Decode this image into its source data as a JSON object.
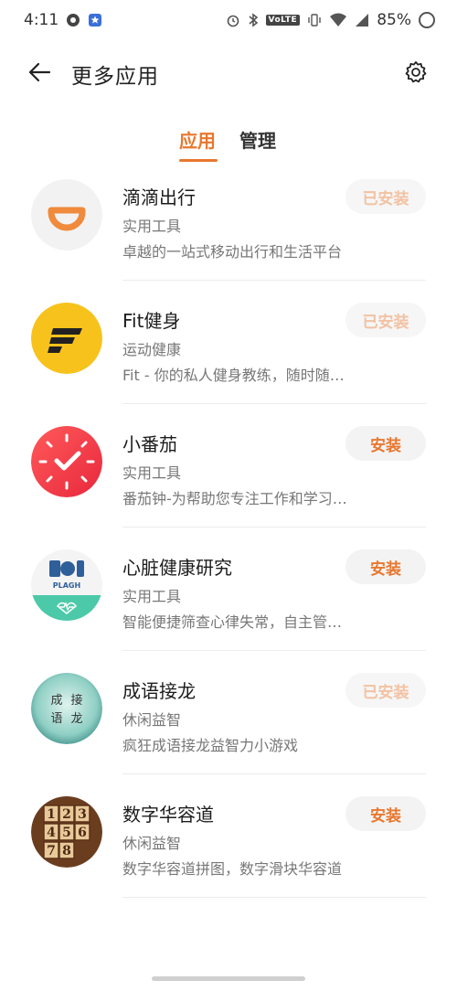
{
  "status_bar": {
    "time": "4:11",
    "battery": "85%",
    "network_label": "VoLTE",
    "icons_left": [
      "soccer-ball-icon",
      "star-badge-icon"
    ],
    "icons_right": [
      "alarm-icon",
      "bluetooth-icon",
      "volte-icon",
      "vibrate-icon",
      "wifi-icon",
      "signal-icon",
      "battery-icon"
    ]
  },
  "header": {
    "title": "更多应用"
  },
  "tabs": [
    {
      "label": "应用",
      "active": true
    },
    {
      "label": "管理",
      "active": false
    }
  ],
  "apps": [
    {
      "name": "滴滴出行",
      "category": "实用工具",
      "description": "卓越的一站式移动出行和生活平台",
      "button": "已安装",
      "installed": true,
      "icon": "didi-logo-icon"
    },
    {
      "name": "Fit健身",
      "category": "运动健康",
      "description": "Fit - 你的私人健身教练，随时随…",
      "button": "已安装",
      "installed": true,
      "icon": "fit-logo-icon"
    },
    {
      "name": "小番茄",
      "category": "实用工具",
      "description": "番茄钟-为帮助您专注工作和学习…",
      "button": "安装",
      "installed": false,
      "icon": "tomato-clock-icon"
    },
    {
      "name": "心脏健康研究",
      "category": "实用工具",
      "description": "智能便捷筛查心律失常，自主管…",
      "button": "安装",
      "installed": false,
      "icon": "heart-health-icon",
      "icon_text": "PLAGH"
    },
    {
      "name": "成语接龙",
      "category": "休闲益智",
      "description": "疯狂成语接龙益智力小游戏",
      "button": "已安装",
      "installed": true,
      "icon": "idiom-game-icon",
      "icon_chars": [
        "成",
        "接",
        "语",
        "龙"
      ]
    },
    {
      "name": "数字华容道",
      "category": "休闲益智",
      "description": "数字华容道拼图，数字滑块华容道",
      "button": "安装",
      "installed": false,
      "icon": "number-puzzle-icon",
      "icon_chars": [
        "1",
        "2",
        "3",
        "4",
        "5",
        "6",
        "7",
        "8"
      ]
    }
  ],
  "colors": {
    "accent": "#e8772e",
    "installed_text": "#f2c2a3",
    "button_bg": "#f3f3f3"
  }
}
